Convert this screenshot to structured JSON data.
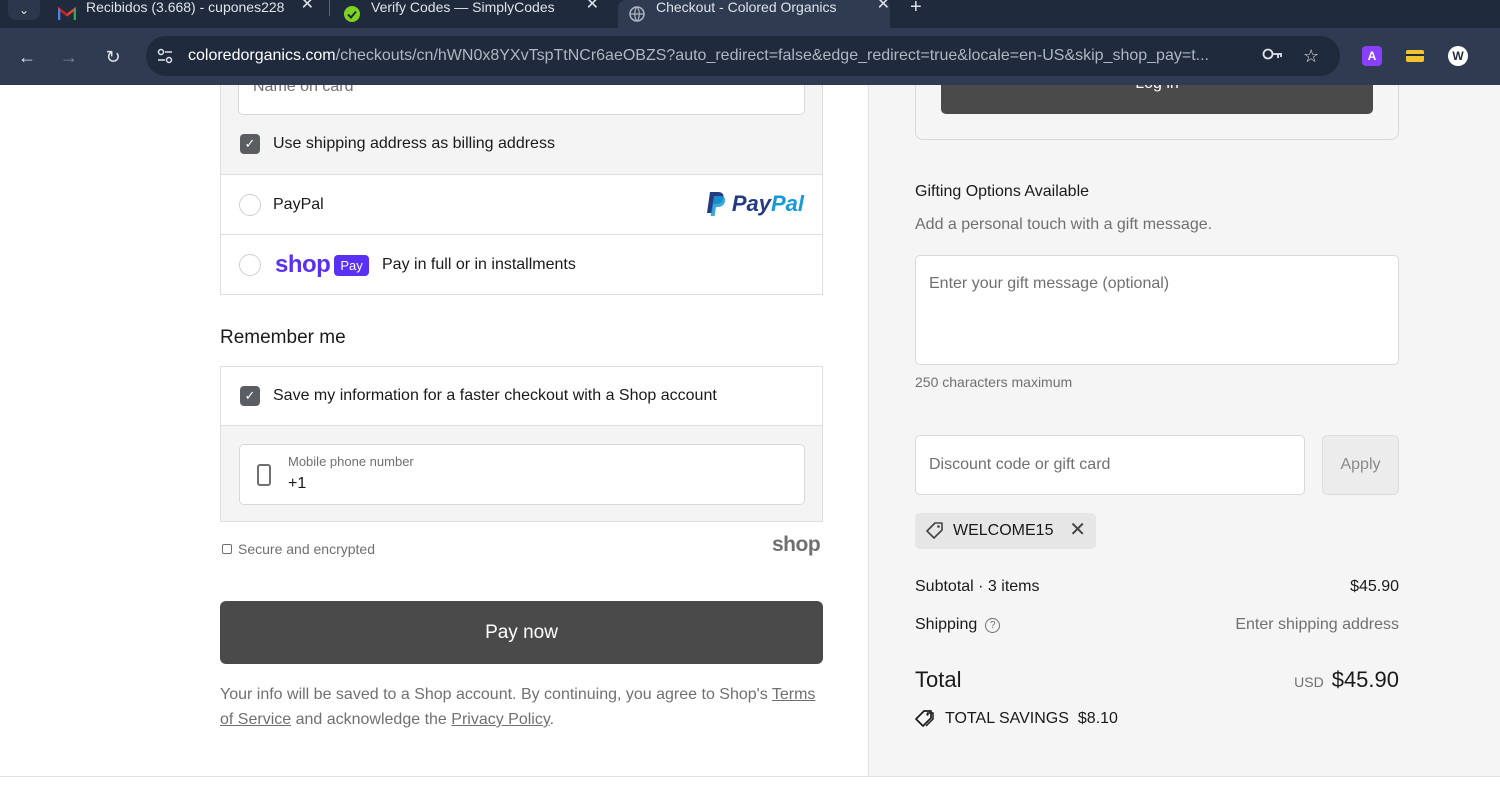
{
  "browser": {
    "tabs": [
      {
        "title": "Recibidos (3.668) - cupones228",
        "icon": "gmail-icon"
      },
      {
        "title": "Verify Codes — SimplyCodes",
        "icon": "simplycodes-icon"
      },
      {
        "title": "Checkout - Colored Organics",
        "icon": "globe-icon"
      }
    ],
    "url_domain": "coloredorganics.com",
    "url_path": "/checkouts/cn/hWN0x8YXvTspTtNCr6aeOBZS?auto_redirect=false&edge_redirect=true&locale=en-US&skip_shop_pay=t...",
    "extensions": [
      {
        "label": "A",
        "color": "#8a3ffc"
      },
      {
        "label": "",
        "color": "#f4c430"
      },
      {
        "label": "W",
        "color": "#ffffff"
      }
    ]
  },
  "billing": {
    "name_placeholder": "Name on card",
    "use_shipping_label": "Use shipping address as billing address",
    "use_shipping_checked": true
  },
  "payment_options": {
    "paypal_label": "PayPal",
    "paypal_logo_text_1": "Pay",
    "paypal_logo_text_2": "Pal",
    "shop_word": "shop",
    "shop_pay_badge": "Pay",
    "shop_pay_label": "Pay in full or in installments"
  },
  "remember": {
    "title": "Remember me",
    "save_label": "Save my information for a faster checkout with a Shop account",
    "save_checked": true,
    "phone_label": "Mobile phone number",
    "phone_value": "+1"
  },
  "security": {
    "secure_label": "Secure and encrypted",
    "shop_brand": "shop"
  },
  "actions": {
    "pay_now": "Pay now"
  },
  "legal": {
    "text_1": "Your info will be saved to a Shop account. By continuing, you agree to Shop's ",
    "terms": "Terms of Service",
    "text_2": " and acknowledge the ",
    "privacy": "Privacy Policy",
    "text_3": "."
  },
  "summary": {
    "login_label": "Log in",
    "gift_title": "Gifting Options Available",
    "gift_subtitle": "Add a personal touch with a gift message.",
    "gift_placeholder": "Enter your gift message (optional)",
    "gift_max": "250 characters maximum",
    "discount_placeholder": "Discount code or gift card",
    "apply_label": "Apply",
    "applied_code": "WELCOME15",
    "subtotal_label": "Subtotal · 3 items",
    "subtotal_value": "$45.90",
    "shipping_label": "Shipping",
    "shipping_value": "Enter shipping address",
    "total_label": "Total",
    "total_currency": "USD",
    "total_value": "$45.90",
    "savings_label": "TOTAL SAVINGS",
    "savings_value": "$8.10"
  }
}
